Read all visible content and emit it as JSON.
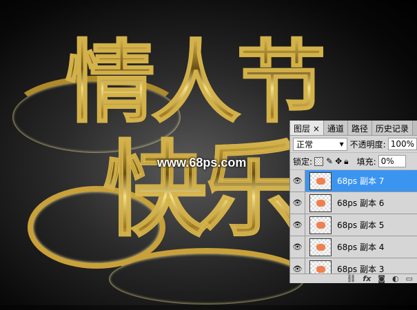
{
  "artwork": {
    "title_line1": "情人节",
    "title_line2": "快乐",
    "watermark": "www.68ps.com"
  },
  "panel": {
    "tabs": [
      {
        "label": "图层 ×"
      },
      {
        "label": "通道"
      },
      {
        "label": "路径"
      },
      {
        "label": "历史记录"
      }
    ],
    "blend_mode": "正常",
    "opacity_label": "不透明度:",
    "opacity_value": "100%",
    "lock_label": "锁定:",
    "fill_label": "填充:",
    "fill_value": "0%",
    "layers": [
      {
        "name": "68ps 副本 7"
      },
      {
        "name": "68ps 副本 6"
      },
      {
        "name": "68ps 副本 5"
      },
      {
        "name": "68ps 副本 4"
      },
      {
        "name": "68ps 副本 3"
      }
    ]
  }
}
